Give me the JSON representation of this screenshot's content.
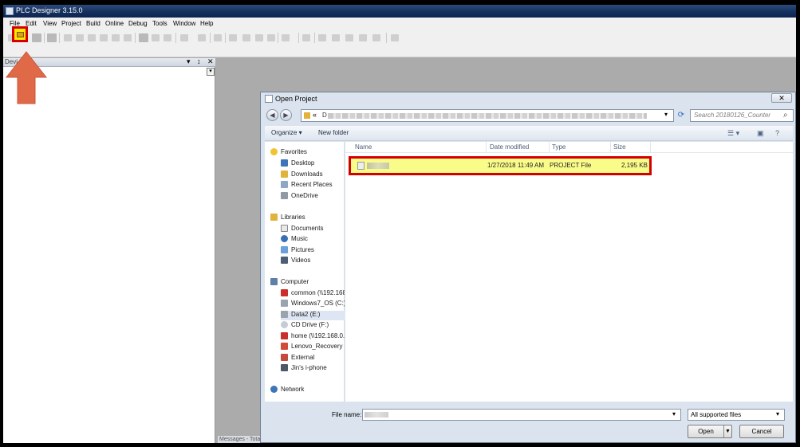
{
  "app": {
    "title": "PLC Designer 3.15.0"
  },
  "menu": [
    "File",
    "Edit",
    "View",
    "Project",
    "Build",
    "Online",
    "Debug",
    "Tools",
    "Window",
    "Help"
  ],
  "left_pane": {
    "label": "Devi",
    "pin": "↕",
    "close": "✕",
    "dropdown": "▾"
  },
  "messages_tab": "Messages - Tota...",
  "dialog": {
    "title": "Open Project",
    "close": "✕",
    "address": {
      "prefix": "«",
      "path_start": "D"
    },
    "search_placeholder": "Search 20180126_Counter",
    "organize": "Organize ▾",
    "new_folder": "New folder",
    "nav": {
      "favorites": {
        "label": "Favorites",
        "items": [
          "Desktop",
          "Downloads",
          "Recent Places",
          "OneDrive"
        ]
      },
      "libraries": {
        "label": "Libraries",
        "items": [
          "Documents",
          "Music",
          "Pictures",
          "Videos"
        ]
      },
      "computer": {
        "label": "Computer",
        "items": [
          "common (\\\\192.168",
          "Windows7_OS (C:)",
          "Data2 (E:)",
          "CD Drive (F:)",
          "home (\\\\192.168.0.6",
          "Lenovo_Recovery (Q",
          "External",
          "Jin's i-phone"
        ]
      },
      "network": {
        "label": "Network"
      }
    },
    "columns": [
      "Name",
      "Date modified",
      "Type",
      "Size"
    ],
    "file": {
      "date": "1/27/2018 11:49 AM",
      "type": "PROJECT File",
      "size": "2,195 KB"
    },
    "file_name_label": "File name:",
    "filter": "All supported files",
    "open": "Open",
    "cancel": "Cancel"
  }
}
